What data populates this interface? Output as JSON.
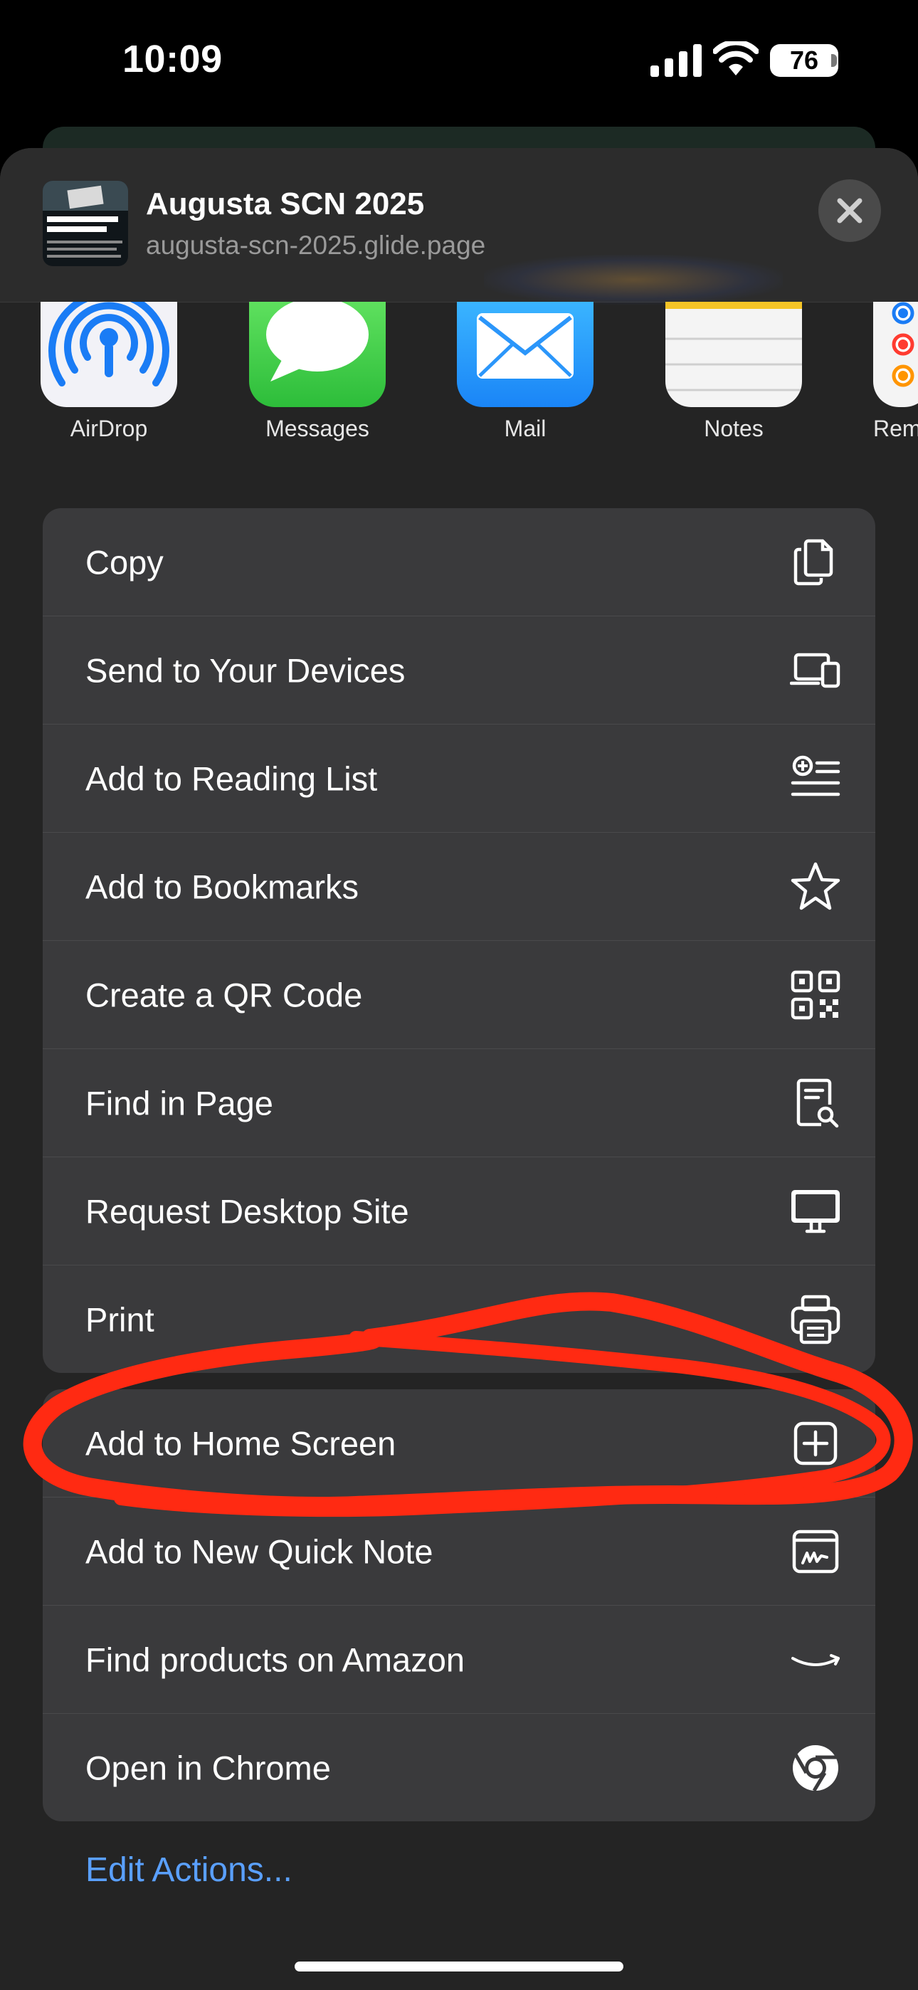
{
  "status_bar": {
    "time": "10:09",
    "battery": "76"
  },
  "share_header": {
    "title": "Augusta SCN 2025",
    "url": "augusta-scn-2025.glide.page",
    "thumbnail_text": [
      "CHAMPIONS",
      "NETWORK",
      "SUMMIT",
      "ALUMNI",
      "THE",
      "WORLD",
      "COURT",
      "Welcome to the SCN Summit – Augusta, Georgia!"
    ]
  },
  "apps": [
    {
      "label": "AirDrop",
      "icon": "airdrop-icon"
    },
    {
      "label": "Messages",
      "icon": "messages-icon"
    },
    {
      "label": "Mail",
      "icon": "mail-icon"
    },
    {
      "label": "Notes",
      "icon": "notes-icon"
    },
    {
      "label": "Rem",
      "icon": "reminders-icon"
    }
  ],
  "actions_group_1": [
    {
      "label": "Copy",
      "icon": "copy-icon"
    },
    {
      "label": "Send to Your Devices",
      "icon": "devices-icon"
    },
    {
      "label": "Add to Reading List",
      "icon": "reading-list-icon"
    },
    {
      "label": "Add to Bookmarks",
      "icon": "star-icon"
    },
    {
      "label": "Create a QR Code",
      "icon": "qr-code-icon"
    },
    {
      "label": "Find in Page",
      "icon": "find-in-page-icon"
    },
    {
      "label": "Request Desktop Site",
      "icon": "desktop-icon"
    },
    {
      "label": "Print",
      "icon": "printer-icon"
    }
  ],
  "actions_group_2": [
    {
      "label": "Add to Home Screen",
      "icon": "plus-square-icon"
    },
    {
      "label": "Add to New Quick Note",
      "icon": "quick-note-icon"
    },
    {
      "label": "Find products on Amazon",
      "icon": "amazon-icon"
    },
    {
      "label": "Open in Chrome",
      "icon": "chrome-icon"
    }
  ],
  "edit_actions_label": "Edit Actions...",
  "colors": {
    "sheet_bg": "#242424",
    "row_bg": "#3a3a3c",
    "link_blue": "#5aa0ff",
    "annotation_red": "#ff2a12"
  }
}
